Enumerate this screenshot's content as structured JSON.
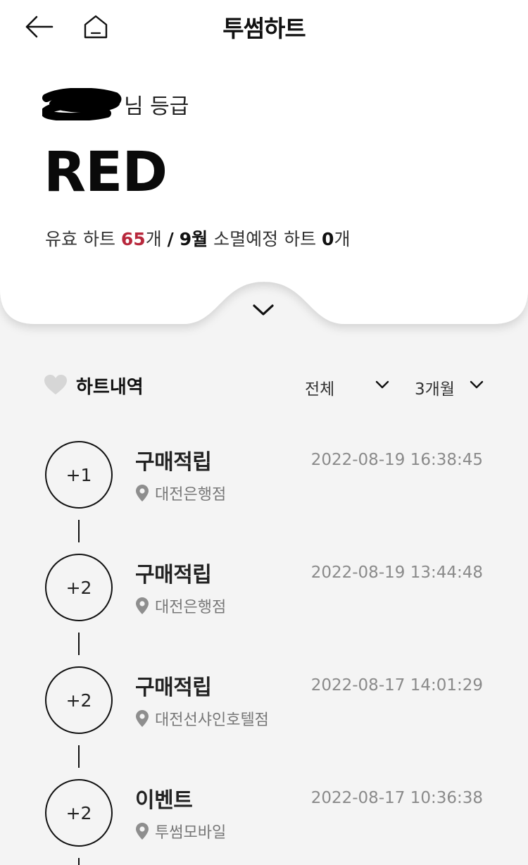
{
  "header": {
    "title": "투썸하트"
  },
  "grade": {
    "suffix": "님 등급",
    "value": "RED"
  },
  "hearts": {
    "valid_label": "유효 하트",
    "valid_count": "65",
    "unit": "개",
    "separator": "/",
    "month": "9월",
    "expire_label": "소멸예정 하트",
    "expire_count": "0"
  },
  "history": {
    "title": "하트내역",
    "filter_type": "전체",
    "filter_period": "3개월",
    "items": [
      {
        "points": "+1",
        "title": "구매적립",
        "date": "2022-08-19 16:38:45",
        "store": "대전은행점"
      },
      {
        "points": "+2",
        "title": "구매적립",
        "date": "2022-08-19 13:44:48",
        "store": "대전은행점"
      },
      {
        "points": "+2",
        "title": "구매적립",
        "date": "2022-08-17 14:01:29",
        "store": "대전선샤인호텔점"
      },
      {
        "points": "+2",
        "title": "이벤트",
        "date": "2022-08-17 10:36:38",
        "store": "투썸모바일"
      }
    ]
  },
  "colors": {
    "accent_red": "#b8283c",
    "background": "#f4f4f4",
    "card": "#ffffff"
  },
  "icons": {
    "back": "arrow-left-icon",
    "home": "home-icon",
    "expand": "chevron-down-icon",
    "section": "heart-icon",
    "store": "location-pin-icon"
  }
}
